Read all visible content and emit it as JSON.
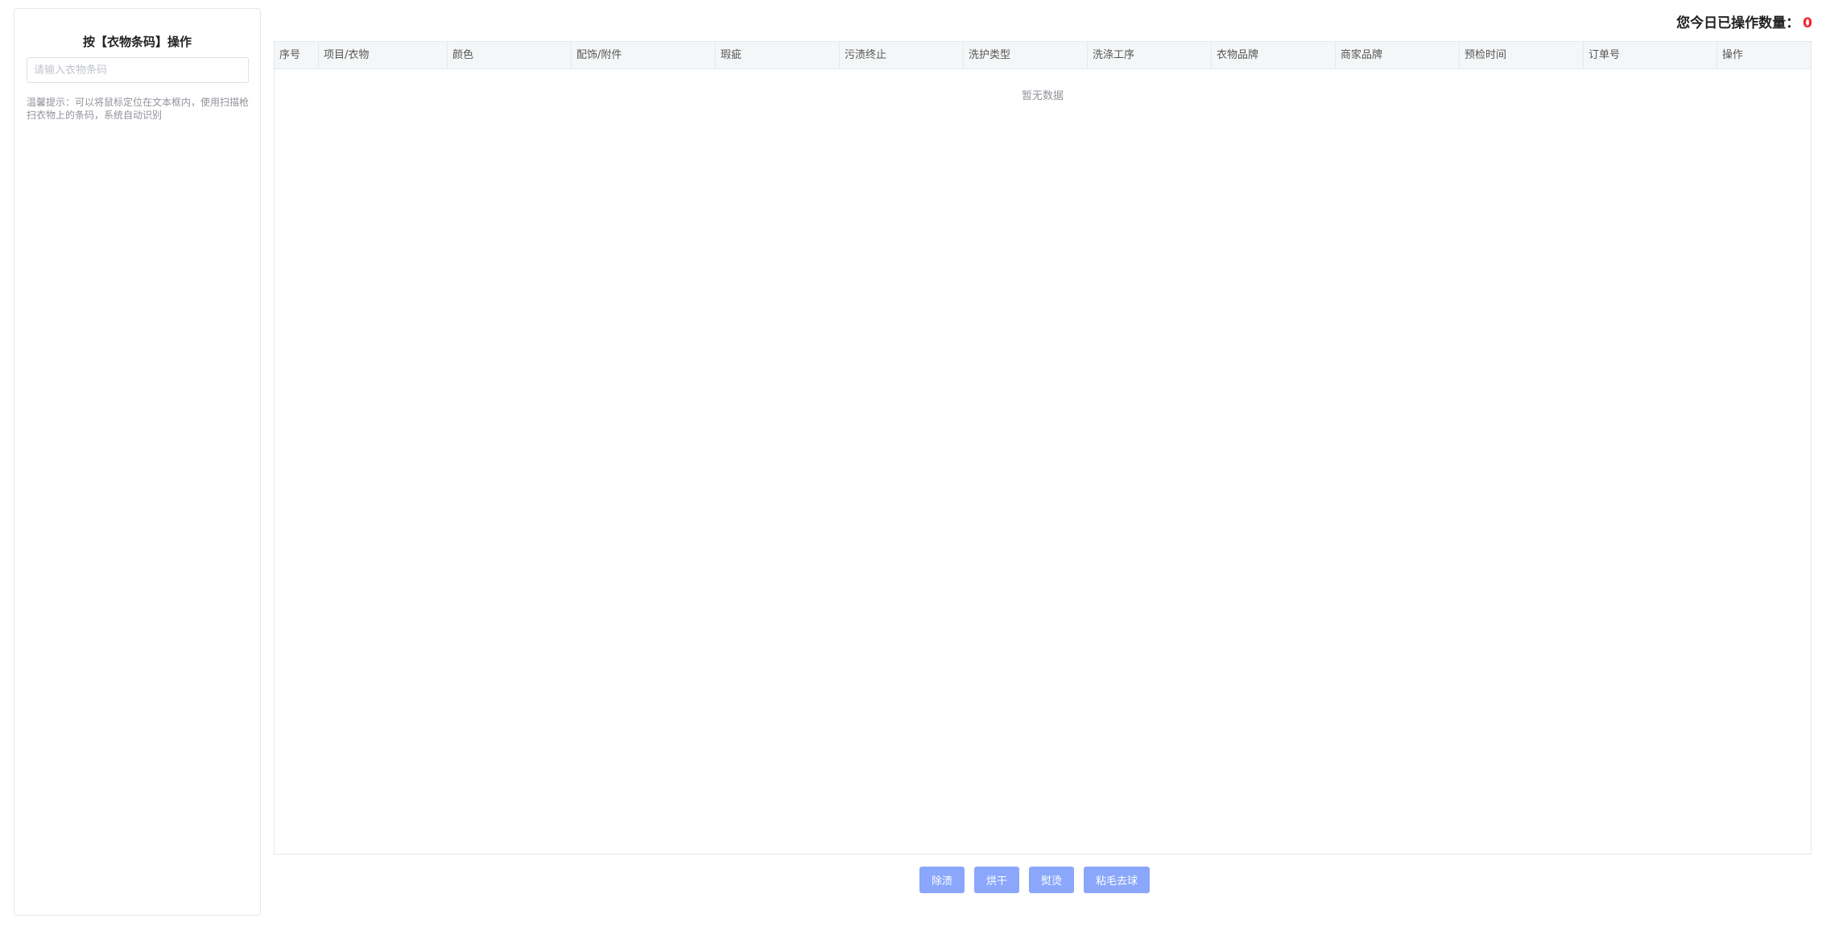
{
  "panel": {
    "title": "按【衣物条码】操作",
    "input_placeholder": "请输入衣物条码",
    "tip": "温馨提示：可以将鼠标定位在文本框内，使用扫描枪扫衣物上的条码，系统自动识别"
  },
  "stats": {
    "label": "您今日已操作数量：",
    "count": "0",
    "count_color": "#f5222d"
  },
  "table": {
    "columns": [
      "序号",
      "项目/衣物",
      "颜色",
      "配饰/附件",
      "瑕疵",
      "污渍终止",
      "洗护类型",
      "洗涤工序",
      "衣物品牌",
      "商家品牌",
      "预检时间",
      "订单号",
      "操作"
    ],
    "empty_text": "暂无数据",
    "rows": []
  },
  "actions": {
    "buttons": [
      "除渍",
      "烘干",
      "熨烫",
      "粘毛去球"
    ],
    "button_color": "#8aa7fb"
  }
}
